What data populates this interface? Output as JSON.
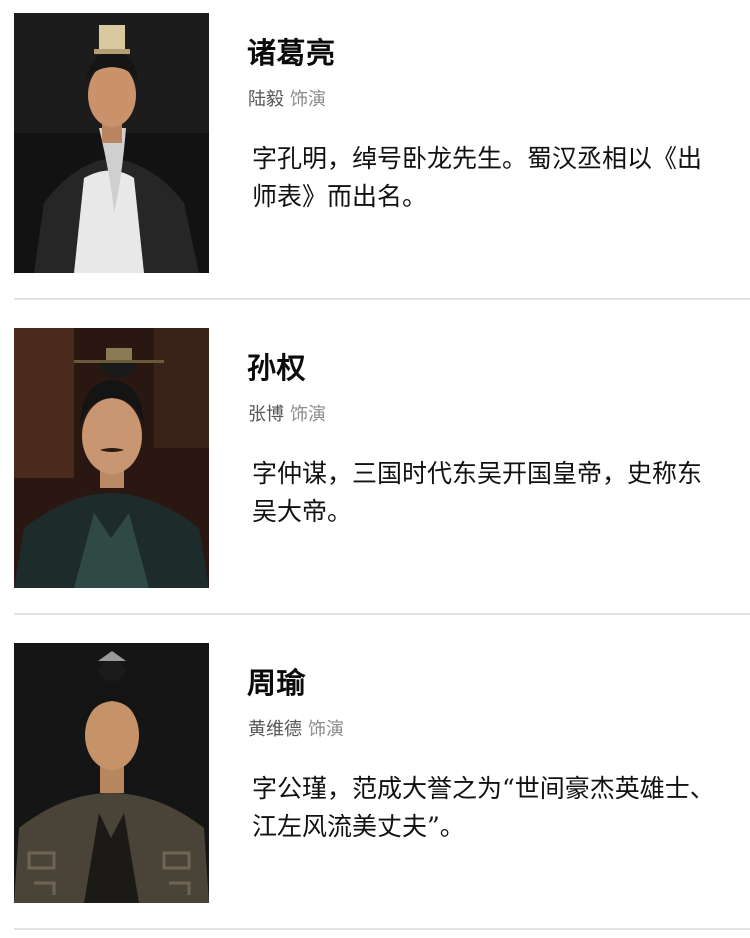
{
  "characters": [
    {
      "name": "诸葛亮",
      "actor": "陆毅",
      "role_label": "饰演",
      "description": "字孔明，绰号卧龙先生。蜀汉丞相以《出师表》而出名。"
    },
    {
      "name": "孙权",
      "actor": "张博",
      "role_label": "饰演",
      "description": "字仲谋，三国时代东吴开国皇帝，史称东吴大帝。"
    },
    {
      "name": "周瑜",
      "actor": "黄维德",
      "role_label": "饰演",
      "description": "字公瑾，范成大誉之为“世间豪杰英雄士、江左风流美丈夫”。"
    }
  ],
  "colors": {
    "name": "#0b0b0b",
    "actor": "#555555",
    "role_label": "#8c8c8c",
    "divider": "#e2e2e2"
  }
}
